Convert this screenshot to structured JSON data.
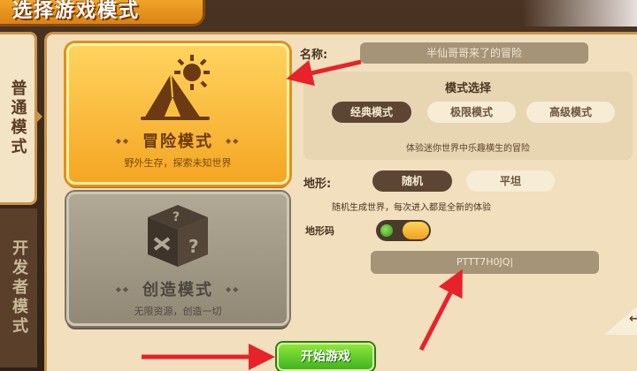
{
  "header": {
    "title": "选择游戏模式"
  },
  "side_tabs": [
    {
      "label": "普通模式",
      "active": true
    },
    {
      "label": "开发者模式",
      "active": false
    }
  ],
  "mode_cards": [
    {
      "name": "冒险模式",
      "desc": "野外生存，探索未知世界",
      "icon": "tent-sun-icon",
      "selected": true
    },
    {
      "name": "创造模式",
      "desc": "无限资源，创造一切",
      "icon": "mystery-box-icon",
      "selected": false
    }
  ],
  "form": {
    "name_label": "名称:",
    "name_value": "半仙哥哥来了的冒险",
    "mode_select_title": "模式选择",
    "mode_options": [
      {
        "label": "经典模式",
        "active": true
      },
      {
        "label": "极限模式",
        "active": false
      },
      {
        "label": "高级模式",
        "active": false
      }
    ],
    "mode_hint": "体验迷你世界中乐趣横生的冒险",
    "terrain_label": "地形:",
    "terrain_options": [
      {
        "label": "随机",
        "active": true
      },
      {
        "label": "平坦",
        "active": false
      }
    ],
    "terrain_hint": "随机生成世界，每次进入都是全新的体验",
    "seed_label": "地形码",
    "seed_toggle_on": true,
    "seed_value": "PTTT7H0JQ|"
  },
  "start_button": {
    "label": "开始游戏"
  },
  "colors": {
    "accent_orange": "#f4a623",
    "panel_bg": "#f2dfbe",
    "start_green": "#3fb51e",
    "arrow_red": "#e8222a"
  }
}
